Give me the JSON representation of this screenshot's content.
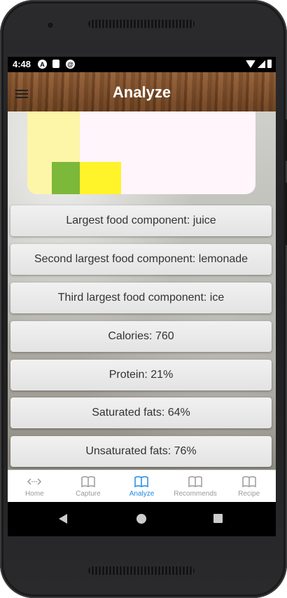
{
  "status_bar": {
    "time": "4:48"
  },
  "app_bar": {
    "title": "Analyze"
  },
  "chart": {
    "colors": [
      "#fdf5a7",
      "#7cb839",
      "#fff32a"
    ]
  },
  "info_items": [
    "Largest food component: juice",
    "Second largest food component: lemonade",
    "Third largest food component: ice",
    "Calories: 760",
    "Protein: 21%",
    "Saturated fats: 64%",
    "Unsaturated fats: 76%"
  ],
  "bottom_nav": {
    "items": [
      {
        "label": "Home",
        "icon": "code-icon",
        "active": false
      },
      {
        "label": "Capture",
        "icon": "book-icon",
        "active": false
      },
      {
        "label": "Analyze",
        "icon": "book-icon",
        "active": true
      },
      {
        "label": "Recommends",
        "icon": "book-icon",
        "active": false
      },
      {
        "label": "Recipe",
        "icon": "book-icon",
        "active": false
      }
    ],
    "active_color": "#1e88e5",
    "inactive_color": "#9a9a9a"
  }
}
